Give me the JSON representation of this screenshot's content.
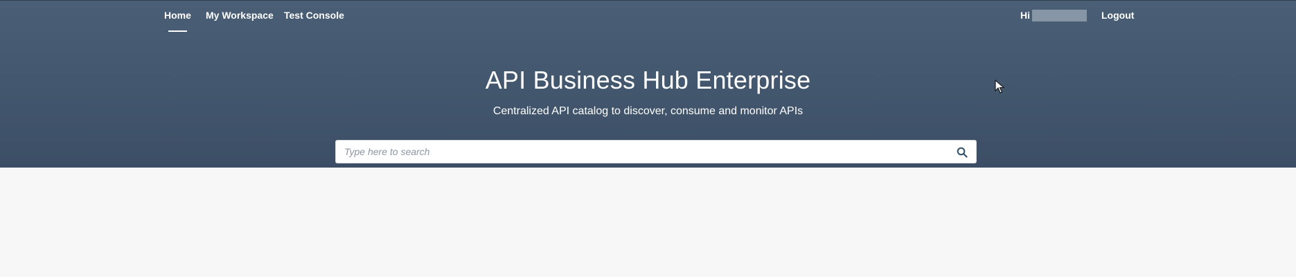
{
  "nav": {
    "items": [
      {
        "label": "Home",
        "active": true
      },
      {
        "label": "My Workspace",
        "active": false
      },
      {
        "label": "Test Console",
        "active": false
      }
    ],
    "greeting": "Hi",
    "logout_label": "Logout"
  },
  "hero": {
    "title": "API Business Hub Enterprise",
    "subtitle": "Centralized API catalog to discover, consume and monitor APIs"
  },
  "search": {
    "placeholder": "Type here to search",
    "value": ""
  },
  "colors": {
    "header_background": "#42566d",
    "page_background": "#f7f7f7",
    "accent": "#ffffff"
  },
  "icons": {
    "search": "search-icon",
    "cursor": "mouse-pointer-icon"
  }
}
